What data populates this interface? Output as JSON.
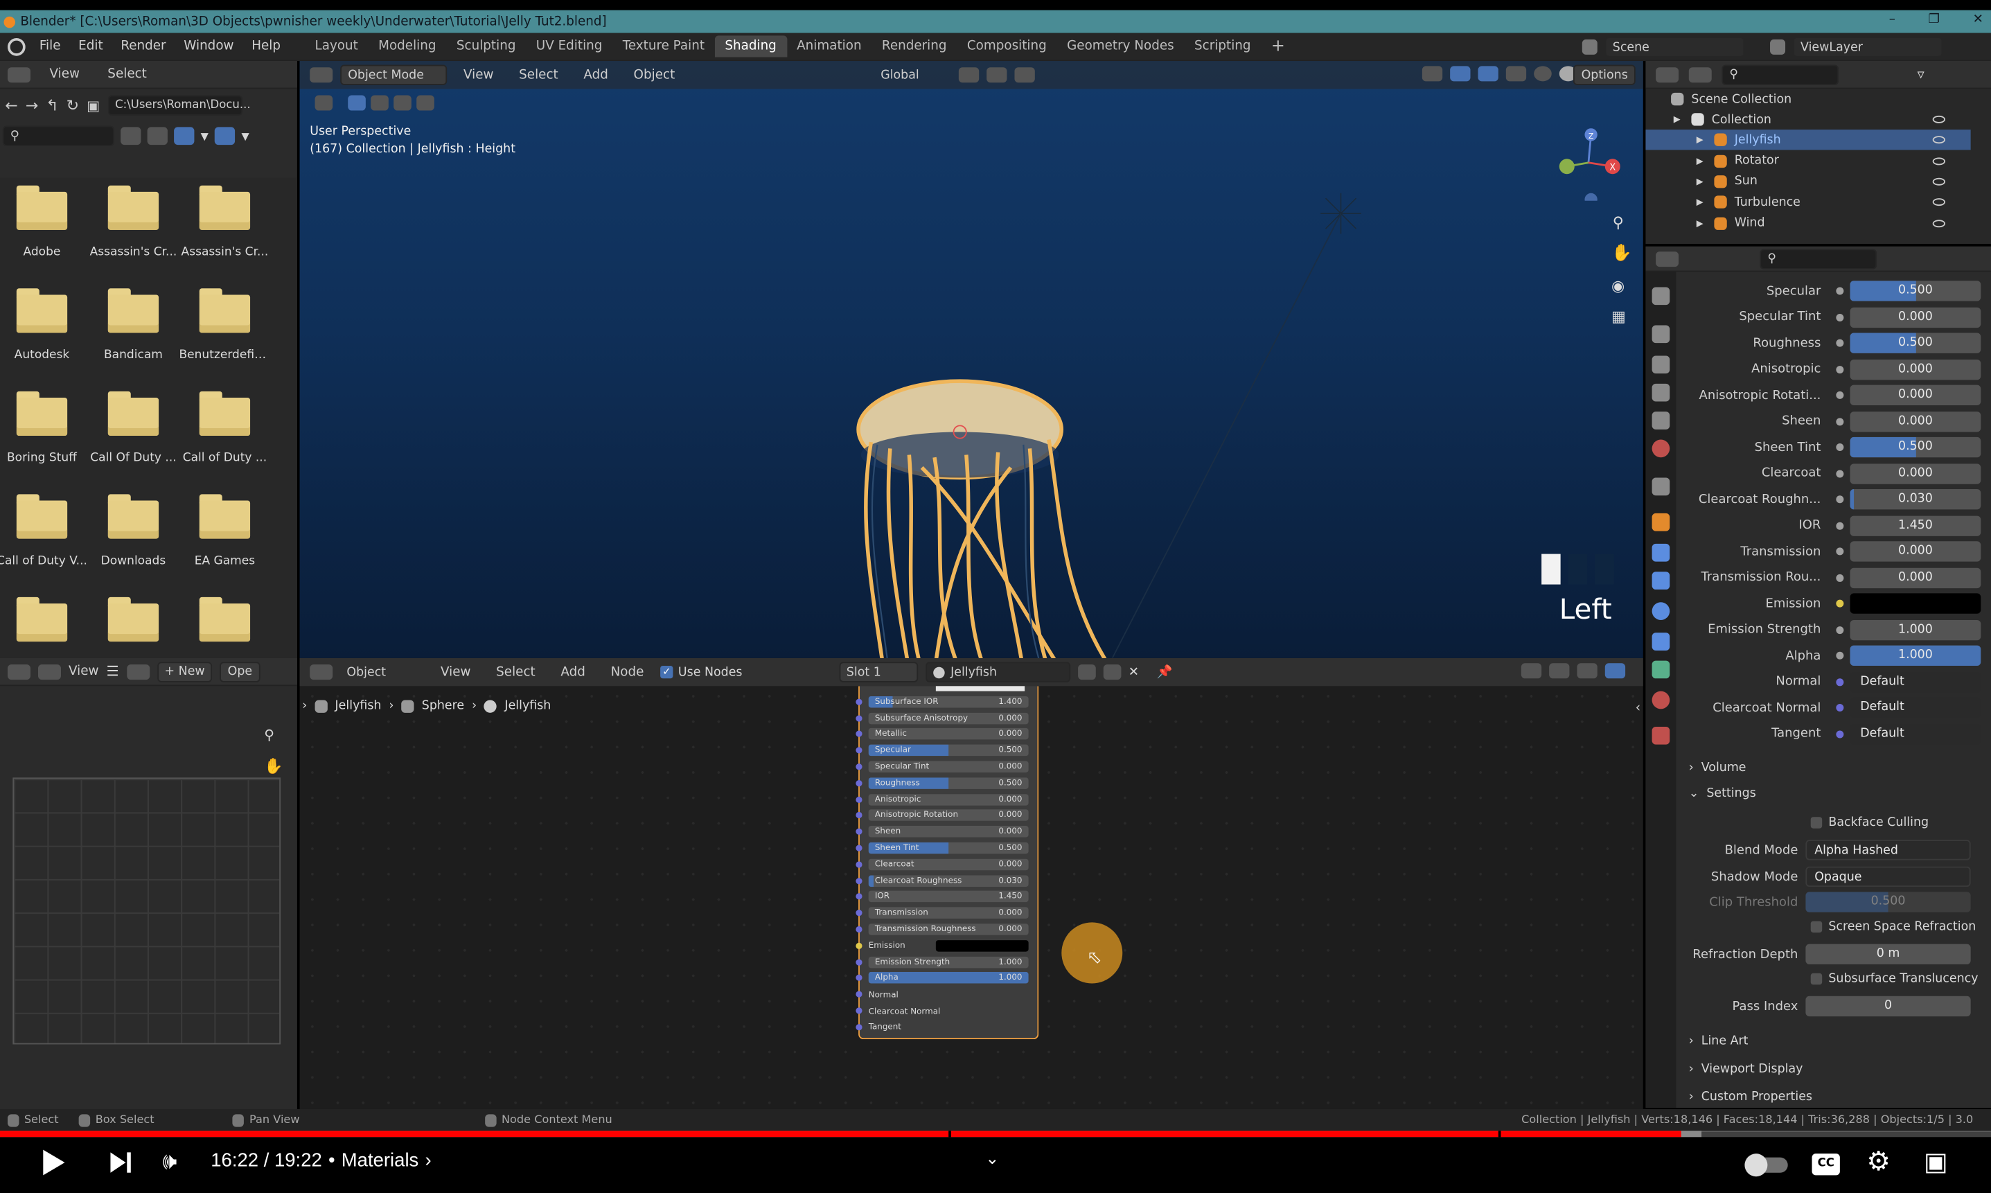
{
  "window": {
    "title": "Blender* [C:\\Users\\Roman\\3D Objects\\pwnisher weekly\\Underwater\\Tutorial\\Jelly Tut2.blend]"
  },
  "menu": {
    "items": [
      "File",
      "Edit",
      "Render",
      "Window",
      "Help"
    ]
  },
  "workspaces": {
    "tabs": [
      "Layout",
      "Modeling",
      "Sculpting",
      "UV Editing",
      "Texture Paint",
      "Shading",
      "Animation",
      "Rendering",
      "Compositing",
      "Geometry Nodes",
      "Scripting"
    ],
    "active": "Shading",
    "add": "+"
  },
  "scene": {
    "name": "Scene",
    "view_layer": "ViewLayer"
  },
  "file_browser": {
    "menu": [
      "View",
      "Select"
    ],
    "path": "C:\\Users\\Roman\\Docu...",
    "folders": [
      "Adobe",
      "Assassin's Cr...",
      "Assassin's Cr...",
      "Autodesk",
      "Bandicam",
      "Benutzerdefin...",
      "Boring Stuff",
      "Call Of Duty ...",
      "Call of Duty ...",
      "Call of Duty V...",
      "Downloads",
      "EA Games",
      "",
      "",
      ""
    ]
  },
  "viewport": {
    "mode": "Object Mode",
    "menu": [
      "View",
      "Select",
      "Add",
      "Object"
    ],
    "orientation": "Global",
    "options": "Options",
    "info_line1": "User Perspective",
    "info_line2": "(167) Collection | Jellyfish : Height",
    "view_label": "Left",
    "gizmo": {
      "z": "Z",
      "x": "X",
      "y": "Y"
    }
  },
  "outliner": {
    "title": "Scene Collection",
    "items": [
      {
        "label": "Collection",
        "indent": 1
      },
      {
        "label": "Jellyfish",
        "indent": 2,
        "selected": true
      },
      {
        "label": "Rotator",
        "indent": 2
      },
      {
        "label": "Sun",
        "indent": 2
      },
      {
        "label": "Turbulence",
        "indent": 2
      },
      {
        "label": "Wind",
        "indent": 2
      }
    ]
  },
  "properties": {
    "rows": [
      {
        "label": "Specular",
        "value": "0.500",
        "fill": 0.5
      },
      {
        "label": "Specular Tint",
        "value": "0.000",
        "fill": 0
      },
      {
        "label": "Roughness",
        "value": "0.500",
        "fill": 0.5
      },
      {
        "label": "Anisotropic",
        "value": "0.000",
        "fill": 0
      },
      {
        "label": "Anisotropic Rotati...",
        "value": "0.000",
        "fill": 0
      },
      {
        "label": "Sheen",
        "value": "0.000",
        "fill": 0
      },
      {
        "label": "Sheen Tint",
        "value": "0.500",
        "fill": 0.5
      },
      {
        "label": "Clearcoat",
        "value": "0.000",
        "fill": 0
      },
      {
        "label": "Clearcoat Roughn...",
        "value": "0.030",
        "fill": 0.03
      },
      {
        "label": "IOR",
        "value": "1.450",
        "fill": 0
      },
      {
        "label": "Transmission",
        "value": "0.000",
        "fill": 0
      },
      {
        "label": "Transmission Rou...",
        "value": "0.000",
        "fill": 0
      },
      {
        "label": "Emission",
        "value": "",
        "fill": 0,
        "color": "#000000"
      },
      {
        "label": "Emission Strength",
        "value": "1.000",
        "fill": 0
      },
      {
        "label": "Alpha",
        "value": "1.000",
        "fill": 1
      },
      {
        "label": "Normal",
        "value": "Default",
        "fill": 0,
        "dark": true
      },
      {
        "label": "Clearcoat Normal",
        "value": "Default",
        "fill": 0,
        "dark": true
      },
      {
        "label": "Tangent",
        "value": "Default",
        "fill": 0,
        "dark": true
      }
    ],
    "sections": {
      "volume": "Volume",
      "settings": "Settings",
      "line_art": "Line Art",
      "viewport_display": "Viewport Display",
      "custom_properties": "Custom Properties"
    },
    "settings": {
      "backface_culling": "Backface Culling",
      "blend_mode_label": "Blend Mode",
      "blend_mode": "Alpha Hashed",
      "shadow_mode_label": "Shadow Mode",
      "shadow_mode": "Opaque",
      "clip_threshold_label": "Clip Threshold",
      "clip_threshold": "0.500",
      "screen_space_refraction": "Screen Space Refraction",
      "refraction_depth_label": "Refraction Depth",
      "refraction_depth": "0 m",
      "subsurface_translucency": "Subsurface Translucency",
      "pass_index_label": "Pass Index",
      "pass_index": "0"
    }
  },
  "image_editor": {
    "view": "View",
    "new": "New",
    "open": "Ope"
  },
  "node_editor": {
    "object": "Object",
    "menu": [
      "View",
      "Select",
      "Add",
      "Node"
    ],
    "use_nodes": "Use Nodes",
    "slot": "Slot 1",
    "material": "Jellyfish",
    "breadcrumb": [
      "Jellyfish",
      "Sphere",
      "Jellyfish"
    ],
    "node_rows": [
      {
        "label": "Subsurface IOR",
        "value": "1.400",
        "fill": 0.15
      },
      {
        "label": "Subsurface Anisotropy",
        "value": "0.000",
        "fill": 0
      },
      {
        "label": "Metallic",
        "value": "0.000",
        "fill": 0
      },
      {
        "label": "Specular",
        "value": "0.500",
        "fill": 0.5
      },
      {
        "label": "Specular Tint",
        "value": "0.000",
        "fill": 0
      },
      {
        "label": "Roughness",
        "value": "0.500",
        "fill": 0.5
      },
      {
        "label": "Anisotropic",
        "value": "0.000",
        "fill": 0
      },
      {
        "label": "Anisotropic Rotation",
        "value": "0.000",
        "fill": 0
      },
      {
        "label": "Sheen",
        "value": "0.000",
        "fill": 0
      },
      {
        "label": "Sheen Tint",
        "value": "0.500",
        "fill": 0.5
      },
      {
        "label": "Clearcoat",
        "value": "0.000",
        "fill": 0
      },
      {
        "label": "Clearcoat Roughness",
        "value": "0.030",
        "fill": 0.03
      },
      {
        "label": "IOR",
        "value": "1.450",
        "fill": 0
      },
      {
        "label": "Transmission",
        "value": "0.000",
        "fill": 0
      },
      {
        "label": "Transmission Roughness",
        "value": "0.000",
        "fill": 0
      },
      {
        "label": "Emission",
        "value": "",
        "fill": 0,
        "color": true
      },
      {
        "label": "Emission Strength",
        "value": "1.000",
        "fill": 0
      },
      {
        "label": "Alpha",
        "value": "1.000",
        "fill": 1
      },
      {
        "label": "Normal",
        "value": "",
        "plain": true
      },
      {
        "label": "Clearcoat Normal",
        "value": "",
        "plain": true
      },
      {
        "label": "Tangent",
        "value": "",
        "plain": true
      }
    ]
  },
  "status_bar": {
    "select": "Select",
    "box_select": "Box Select",
    "pan_view": "Pan View",
    "node_context_menu": "Node Context Menu",
    "stats": "Collection | Jellyfish | Verts:18,146 | Faces:18,144 | Tris:36,288 | Objects:1/5 | 3.0"
  },
  "player": {
    "time": "16:22 / 19:22",
    "chapter": "Materials",
    "progress": 0.8443,
    "buffered": 0.8545,
    "chapter_marks": [
      0.4764,
      0.7523
    ],
    "colors": {
      "progress": "#ff0000",
      "buffered": "#8a8a8a"
    }
  },
  "colors": {
    "accent": "#4772b3",
    "title_bar": "#4a8c95",
    "viewport_top": "#153e72",
    "viewport_bottom": "#0c1f3b",
    "jelly": "#f0b65a"
  }
}
